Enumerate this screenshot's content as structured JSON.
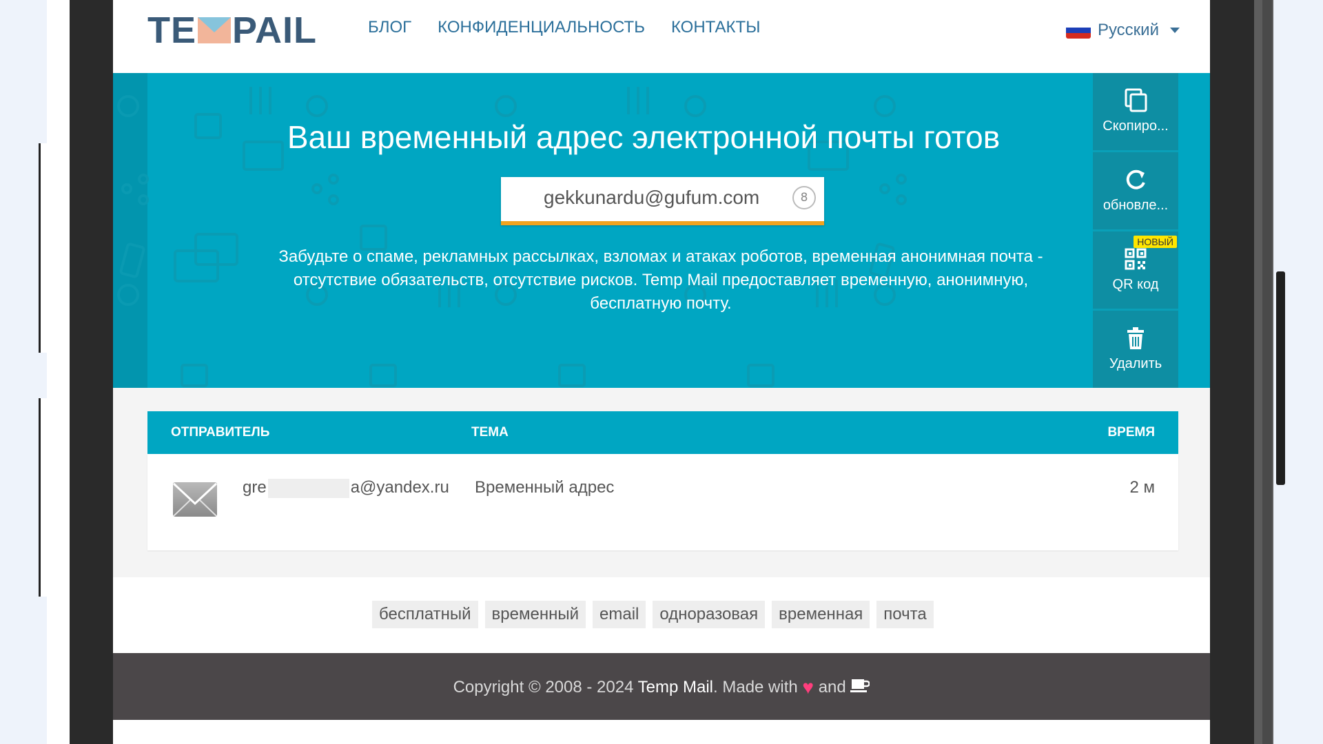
{
  "header": {
    "logo_text_left": "TE",
    "logo_text_right": "PAIL",
    "nav": [
      "БЛОГ",
      "КОНФИДЕНЦИАЛЬНОСТЬ",
      "КОНТАКТЫ"
    ],
    "language": "Русский"
  },
  "hero": {
    "title": "Ваш временный адрес электронной почты готов",
    "email": "gekkunardu@gufum.com",
    "refresh_counter": "8",
    "description": "Забудьте о спаме, рекламных рассылках, взломах и атаках роботов, временная анонимная почта - отсутствие обязательств, отсутствие рисков. Temp Mail предоставляет временную, анонимную, бесплатную почту."
  },
  "actions": {
    "copy_label": "Скопиро...",
    "refresh_label": "обновле...",
    "qr_label": "QR код",
    "qr_badge": "НОВЫЙ",
    "delete_label": "Удалить"
  },
  "inbox": {
    "headers": {
      "sender": "ОТПРАВИТЕЛЬ",
      "subject": "ТЕМА",
      "time": "ВРЕМЯ"
    },
    "rows": [
      {
        "sender_start": "gre",
        "sender_end": "a@yandex.ru",
        "subject": "Временный адрес",
        "time": "2 м"
      }
    ]
  },
  "tags": [
    "бесплатный",
    "временный",
    "email",
    "одноразовая",
    "временная",
    "почта"
  ],
  "footer": {
    "copyright": "Copyright © 2008 - 2024 ",
    "brand": "Temp Mail",
    "made_with": ". Made with ",
    "and": " and "
  },
  "colors": {
    "accent": "#00a6c2",
    "action_bg": "#0e8ea3",
    "email_underline": "#f2a31f",
    "badge": "#ffe600",
    "footer_bg": "#4b4749",
    "heart": "#ff3e7d"
  },
  "icons": [
    "copy-icon",
    "refresh-icon",
    "qr-code-icon",
    "trash-icon",
    "envelope-icon",
    "heart-icon",
    "coffee-icon",
    "russia-flag-icon",
    "chevron-down-icon"
  ]
}
